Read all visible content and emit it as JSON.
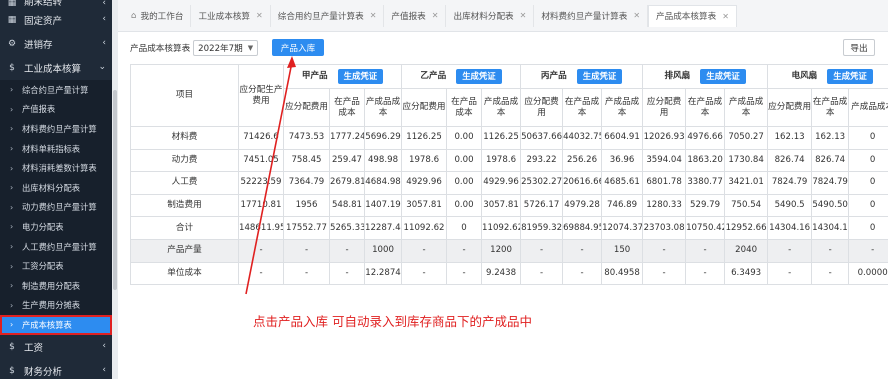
{
  "sidebar": {
    "top_partial": "期末结转",
    "main_items": [
      {
        "label": "固定资产",
        "icon": "table-icon"
      },
      {
        "label": "进销存",
        "icon": "gear-icon"
      },
      {
        "label": "工业成本核算",
        "icon": "dollar-icon"
      }
    ],
    "sub_items": [
      "综合约旦产量计算",
      "产值报表",
      "材料费约旦产量计算",
      "材料单耗指标表",
      "材料消耗差数计算表",
      "出库材料分配表",
      "动力费约旦产量计算",
      "电力分配表",
      "人工费约旦产量计算",
      "工资分配表",
      "制造费用分配表",
      "生产费用分摊表",
      "产成本核算表"
    ],
    "bottom_items": [
      {
        "label": "工资",
        "icon": "dollar-icon"
      },
      {
        "label": "财务分析",
        "icon": "dollar-icon"
      }
    ]
  },
  "tabs": [
    {
      "label": "我的工作台",
      "home": true
    },
    {
      "label": "工业成本核算"
    },
    {
      "label": "综合用约旦产量计算表"
    },
    {
      "label": "产值报表"
    },
    {
      "label": "出库材料分配表"
    },
    {
      "label": "材料费约旦产量计算表"
    },
    {
      "label": "产品成本核算表",
      "active": true
    }
  ],
  "toolbar": {
    "period_label": "产品成本核算表",
    "period_value": "2022年7期",
    "stock_in_label": "产品入库",
    "export_label": "导出"
  },
  "table": {
    "item_header": "项目",
    "alloc_header": "应分配生产费用",
    "gen_label": "生成凭证",
    "groups": [
      "甲产品",
      "乙产品",
      "丙产品",
      "排风扇",
      "电风扇"
    ],
    "sub_headers": [
      "应分配费用",
      "在产品成本",
      "产成品成本"
    ],
    "rows": [
      {
        "name": "材料费",
        "alloc": "71426.6",
        "vals": [
          "7473.53",
          "1777.24",
          "5696.29",
          "1126.25",
          "0.00",
          "1126.25",
          "50637.66",
          "44032.75",
          "6604.91",
          "12026.93",
          "4976.66",
          "7050.27",
          "162.13",
          "162.13",
          "0"
        ]
      },
      {
        "name": "动力费",
        "alloc": "7451.05",
        "vals": [
          "758.45",
          "259.47",
          "498.98",
          "1978.6",
          "0.00",
          "1978.6",
          "293.22",
          "256.26",
          "36.96",
          "3594.04",
          "1863.20",
          "1730.84",
          "826.74",
          "826.74",
          "0"
        ]
      },
      {
        "name": "人工费",
        "alloc": "52223.59",
        "vals": [
          "7364.79",
          "2679.81",
          "4684.98",
          "4929.96",
          "0.00",
          "4929.96",
          "25302.27",
          "20616.66",
          "4685.61",
          "6801.78",
          "3380.77",
          "3421.01",
          "7824.79",
          "7824.79",
          "0"
        ]
      },
      {
        "name": "制造费用",
        "alloc": "17710.81",
        "vals": [
          "1956",
          "548.81",
          "1407.19",
          "3057.81",
          "0.00",
          "3057.81",
          "5726.17",
          "4979.28",
          "746.89",
          "1280.33",
          "529.79",
          "750.54",
          "5490.5",
          "5490.50",
          "0"
        ]
      },
      {
        "name": "合计",
        "alloc": "148611.95",
        "vals": [
          "17552.77",
          "5265.33",
          "12287.44",
          "11092.62",
          "0",
          "11092.62",
          "81959.32",
          "69884.95",
          "12074.37",
          "23703.08",
          "10750.42",
          "12952.66",
          "14304.16",
          "14304.16",
          "0"
        ]
      },
      {
        "name": "产品产量",
        "alloc": "-",
        "gray": true,
        "vals": [
          "-",
          "-",
          "1000",
          "-",
          "-",
          "1200",
          "-",
          "-",
          "150",
          "-",
          "-",
          "2040",
          "-",
          "-",
          "-"
        ]
      },
      {
        "name": "单位成本",
        "alloc": "-",
        "vals": [
          "-",
          "-",
          "12.2874",
          "-",
          "-",
          "9.2438",
          "-",
          "-",
          "80.4958",
          "-",
          "-",
          "6.3493",
          "-",
          "-",
          "0.0000"
        ]
      }
    ]
  },
  "annotation": {
    "text": "点击产品入库  可自动录入到库存商品下的产成品中",
    "color": "#e02020"
  },
  "colors": {
    "sidebar_bg": "#1f2a38",
    "accent": "#2d8cf0",
    "annotation_red": "#e02020"
  }
}
